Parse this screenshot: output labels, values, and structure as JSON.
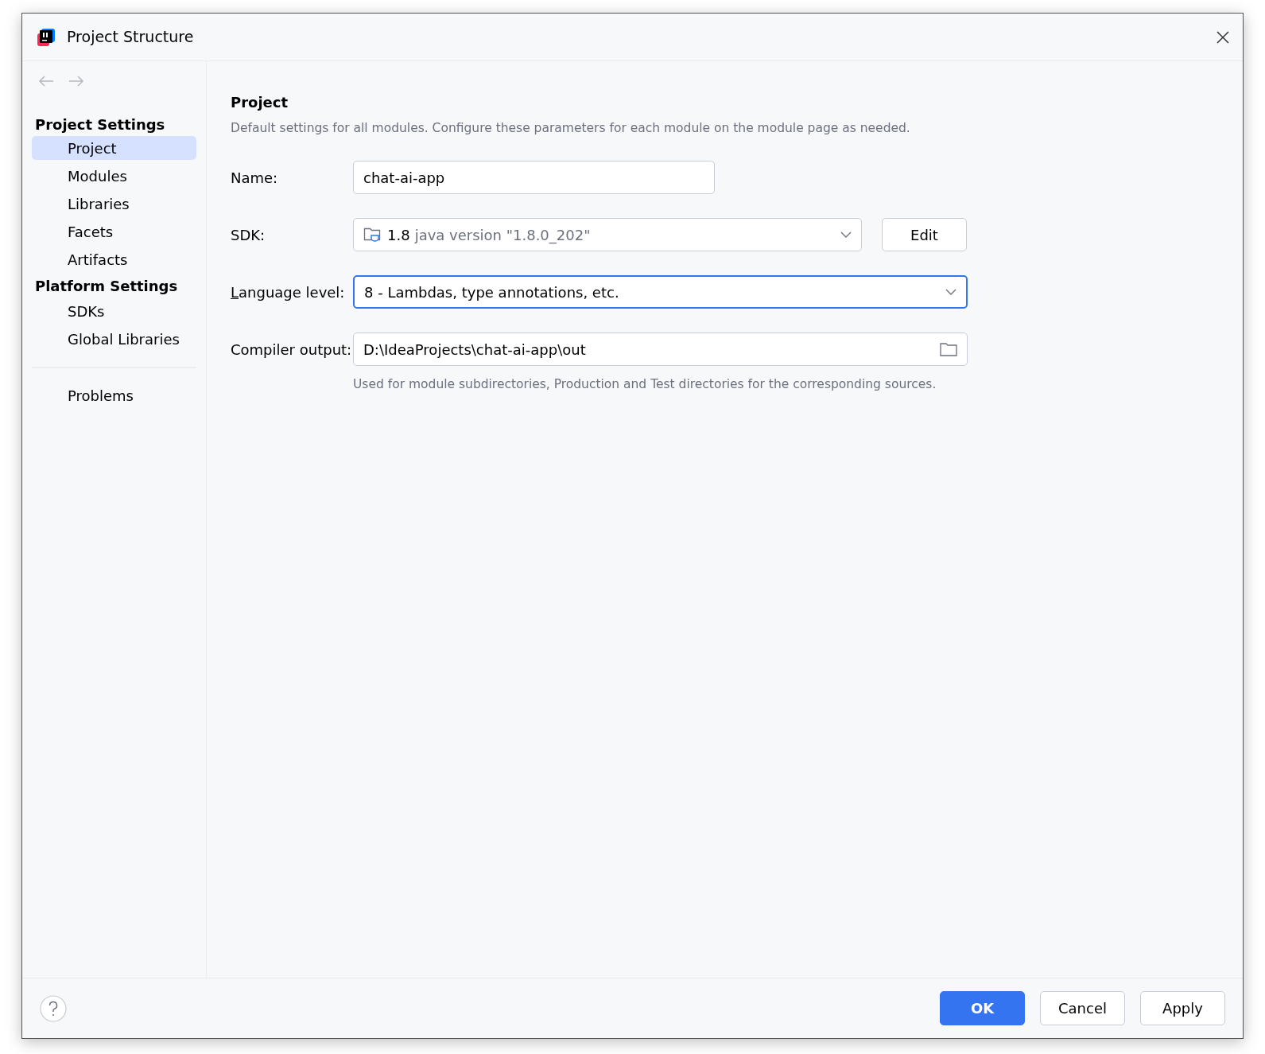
{
  "window": {
    "title": "Project Structure"
  },
  "sidebar": {
    "groups": [
      {
        "heading": "Project Settings",
        "items": [
          {
            "label": "Project",
            "selected": true
          },
          {
            "label": "Modules",
            "selected": false
          },
          {
            "label": "Libraries",
            "selected": false
          },
          {
            "label": "Facets",
            "selected": false
          },
          {
            "label": "Artifacts",
            "selected": false
          }
        ]
      },
      {
        "heading": "Platform Settings",
        "items": [
          {
            "label": "SDKs",
            "selected": false
          },
          {
            "label": "Global Libraries",
            "selected": false
          }
        ]
      }
    ],
    "footer_items": [
      {
        "label": "Problems",
        "selected": false
      }
    ]
  },
  "content": {
    "title": "Project",
    "description": "Default settings for all modules. Configure these parameters for each module on the module page as needed.",
    "name": {
      "label": "Name:",
      "value": "chat-ai-app"
    },
    "sdk": {
      "label": "SDK:",
      "version": "1.8",
      "detail": "java version \"1.8.0_202\"",
      "button": "Edit"
    },
    "language_level": {
      "label": "Language level:",
      "mnemonic": true,
      "value": "8 - Lambdas, type annotations, etc.",
      "focused": true
    },
    "compiler_output": {
      "label": "Compiler output:",
      "value": "D:\\IdeaProjects\\chat-ai-app\\out",
      "hint": "Used for module subdirectories, Production and Test directories for the corresponding sources."
    }
  },
  "buttons": [
    {
      "label": "OK",
      "kind": "primary"
    },
    {
      "label": "Cancel",
      "kind": "secondary"
    },
    {
      "label": "Apply",
      "kind": "secondary"
    }
  ]
}
